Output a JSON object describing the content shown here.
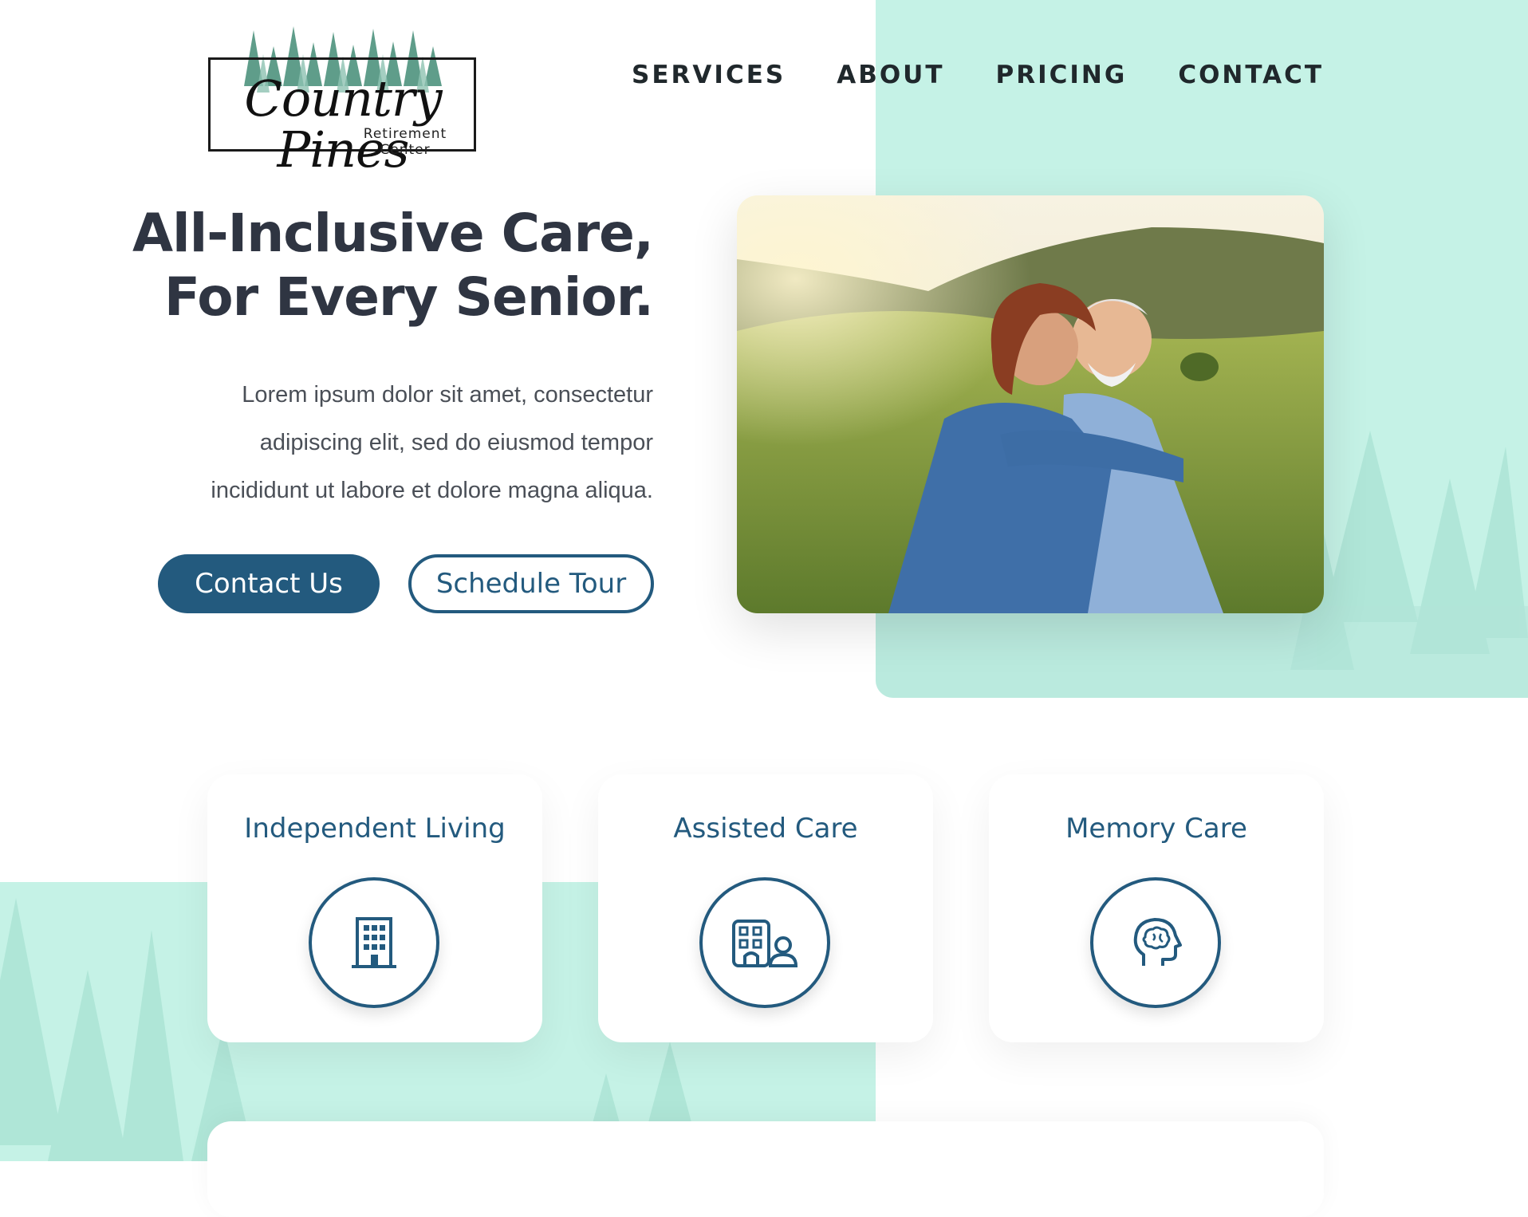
{
  "brand": {
    "name_script": "Country Pines",
    "subtitle": "Retirement Center"
  },
  "nav": {
    "items": [
      {
        "label": "SERVICES"
      },
      {
        "label": "ABOUT"
      },
      {
        "label": "PRICING"
      },
      {
        "label": "CONTACT"
      }
    ]
  },
  "hero": {
    "title_line1": "All-Inclusive Care,",
    "title_line2": "For Every Senior.",
    "body_line1": "Lorem ipsum dolor sit amet, consectetur",
    "body_line2": "adipiscing elit, sed do eiusmod tempor",
    "body_line3": "incididunt ut labore et dolore magna aliqua.",
    "primary_button": "Contact Us",
    "secondary_button": "Schedule Tour"
  },
  "services": [
    {
      "title": "Independent Living",
      "icon": "building-icon"
    },
    {
      "title": "Assisted Care",
      "icon": "building-person-icon"
    },
    {
      "title": "Memory Care",
      "icon": "brain-head-icon"
    }
  ],
  "colors": {
    "accent": "#235a7e",
    "mint": "#c5f2e6",
    "heading": "#2f3542"
  }
}
